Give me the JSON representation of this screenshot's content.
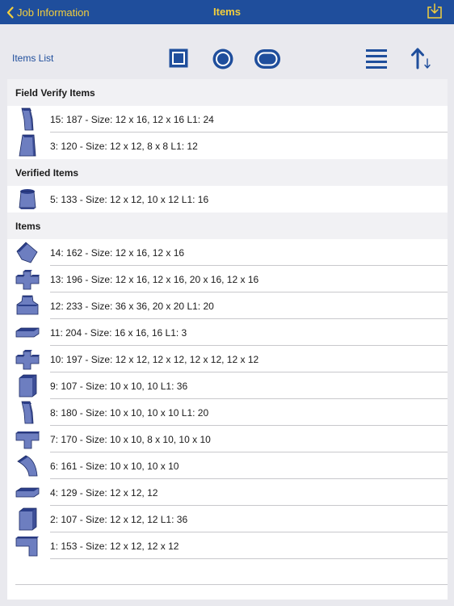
{
  "navbar": {
    "back_label": "Job Information",
    "title": "Items",
    "back_icon": "chevron-left-icon",
    "download_icon": "download-tray-icon"
  },
  "toolbar": {
    "label": "Items List",
    "buttons": [
      {
        "icon": "square-duct-icon"
      },
      {
        "icon": "round-duct-icon"
      },
      {
        "icon": "oval-duct-icon"
      },
      {
        "icon": "list-lines-icon"
      },
      {
        "icon": "sort-icon"
      }
    ]
  },
  "colors": {
    "nav_bg": "#1f4e9c",
    "nav_text": "#f4cf3c",
    "accent": "#1f4e9c",
    "shape_fill": "#6d7ec0",
    "shape_dark": "#2c3f8a"
  },
  "sections": [
    {
      "title": "Field Verify Items",
      "items": [
        {
          "label": "15: 187 - Size: 12 x 16, 12 x 16 L1: 24",
          "icon": "offset-icon"
        },
        {
          "label": "3: 120 - Size: 12 x 12, 8 x 8 L1: 12",
          "icon": "transition-icon"
        }
      ]
    },
    {
      "title": "Verified Items",
      "items": [
        {
          "label": "5: 133 - Size: 12 x 12, 10 x 12 L1: 16",
          "icon": "square-to-round-icon"
        }
      ]
    },
    {
      "title": "Items",
      "items": [
        {
          "label": "14: 162 - Size: 12 x 16, 12 x 16",
          "icon": "elbow-45-icon"
        },
        {
          "label": "13: 196 - Size: 12 x 16, 12 x 16, 20 x 16, 12 x 16",
          "icon": "cross-icon"
        },
        {
          "label": "12: 233 - Size: 36 x 36, 20 x 20 L1: 20",
          "icon": "plenum-icon"
        },
        {
          "label": "11: 204 - Size: 16 x 16, 16 L1: 3",
          "icon": "flat-plate-icon"
        },
        {
          "label": "10: 197 - Size: 12 x 12, 12 x 12, 12 x 12, 12 x 12",
          "icon": "cross-icon"
        },
        {
          "label": "9: 107 - Size: 10 x 10, 10 L1: 36",
          "icon": "straight-duct-icon"
        },
        {
          "label": "8: 180 - Size: 10 x 10, 10 x 10 L1: 20",
          "icon": "offset-icon"
        },
        {
          "label": "7: 170 - Size: 10 x 10, 8 x 10, 10 x 10",
          "icon": "tee-icon"
        },
        {
          "label": "6: 161 - Size: 10 x 10, 10 x 10",
          "icon": "elbow-90-icon"
        },
        {
          "label": "4: 129 - Size: 12 x 12, 12",
          "icon": "flat-plate-icon"
        },
        {
          "label": "2: 107 - Size: 12 x 12, 12 L1: 36",
          "icon": "straight-duct-icon"
        },
        {
          "label": "1: 153 - Size: 12 x 12, 12 x 12",
          "icon": "square-elbow-icon"
        }
      ]
    }
  ]
}
